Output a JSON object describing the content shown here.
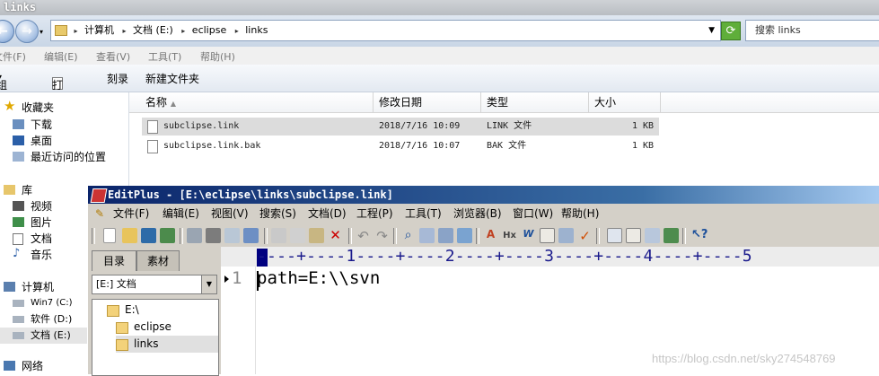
{
  "explorer": {
    "title": "links",
    "breadcrumb": [
      "计算机",
      "文档 (E:)",
      "eclipse",
      "links"
    ],
    "search_placeholder": "搜索 links",
    "menu": [
      "文件(F)",
      "编辑(E)",
      "查看(V)",
      "工具(T)",
      "帮助(H)"
    ],
    "toolbar": {
      "organize": "组织",
      "open": "打开",
      "burn": "刻录",
      "new_folder": "新建文件夹"
    },
    "nav": {
      "favorites": "收藏夹",
      "downloads": "下载",
      "desktop": "桌面",
      "recent": "最近访问的位置",
      "library": "库",
      "videos": "视频",
      "pictures": "图片",
      "documents": "文档",
      "music": "音乐",
      "computer": "计算机",
      "drive_c": "Win7 (C:)",
      "drive_d": "软件 (D:)",
      "drive_e": "文档 (E:)",
      "network": "网络"
    },
    "columns": {
      "name": "名称",
      "modified": "修改日期",
      "type": "类型",
      "size": "大小"
    },
    "files": [
      {
        "name": "subclipse.link",
        "modified": "2018/7/16 10:09",
        "type": "LINK 文件",
        "size": "1 KB"
      },
      {
        "name": "subclipse.link.bak",
        "modified": "2018/7/16 10:07",
        "type": "BAK 文件",
        "size": "1 KB"
      }
    ]
  },
  "editplus": {
    "title": "EditPlus - [E:\\eclipse\\links\\subclipse.link]",
    "menu": [
      "文件(F)",
      "编辑(E)",
      "视图(V)",
      "搜索(S)",
      "文档(D)",
      "工程(P)",
      "工具(T)",
      "浏览器(B)",
      "窗口(W)",
      "帮助(H)"
    ],
    "tabs": {
      "directory": "目录",
      "clipboard": "素材"
    },
    "drive_select": "[E:] 文档",
    "tree": [
      "E:\\",
      "eclipse",
      "links"
    ],
    "ruler": "----+----1----+----2----+----3----+----4----+----5",
    "line_number": "1",
    "code_line": "path=E:\\\\svn"
  },
  "watermark": "https://blog.csdn.net/sky274548769",
  "colors": {
    "ep_title_start": "#0a246a",
    "ep_title_end": "#a6caf0",
    "selection": "#dcdcdc"
  }
}
